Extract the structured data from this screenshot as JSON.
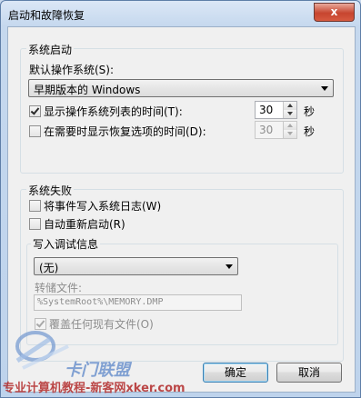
{
  "window": {
    "title": "启动和故障恢复",
    "close_symbol": "x"
  },
  "system_startup": {
    "group_title": "系统启动",
    "default_os_label": "默认操作系统(S):",
    "default_os_value": "早期版本的 Windows",
    "show_list_label": "显示操作系统列表的时间(T):",
    "show_list_checked": true,
    "show_list_value": "30",
    "show_list_unit": "秒",
    "show_recovery_label": "在需要时显示恢复选项的时间(D):",
    "show_recovery_checked": false,
    "show_recovery_value": "30",
    "show_recovery_unit": "秒"
  },
  "system_failure": {
    "group_title": "系统失败",
    "write_event_label": "将事件写入系统日志(W)",
    "write_event_checked": false,
    "auto_restart_label": "自动重新启动(R)",
    "auto_restart_checked": false,
    "debug_info": {
      "group_title": "写入调试信息",
      "type_value": "(无)",
      "dump_file_label": "转储文件:",
      "dump_file_value": "%SystemRoot%\\MEMORY.DMP",
      "overwrite_label": "覆盖任何现有文件(O)",
      "overwrite_checked": true
    }
  },
  "buttons": {
    "ok": "确定",
    "cancel": "取消"
  },
  "watermark": {
    "brand": "卡门联盟",
    "text": "专业计算机教程-新客网xker.com"
  }
}
